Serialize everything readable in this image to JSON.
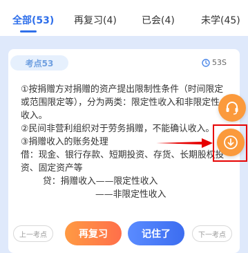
{
  "tabs": [
    {
      "label": "全部(53)",
      "active": true
    },
    {
      "label": "再复习(4)",
      "active": false
    },
    {
      "label": "已会(4)",
      "active": false
    },
    {
      "label": "未学(45)",
      "active": false
    }
  ],
  "card": {
    "tag": "考点53",
    "timer": "53S",
    "lines": [
      "①按捐赠方对捐赠的资产提出限制性条件（时间限定或范围限定等），分为两类：限定性收入和非限定性收入。",
      "②民间非营利组织对于劳务捐赠，不能确认收入。",
      "③捐赠收入的账务处理",
      "借：现金、银行存款、短期投资、存货、长期股权投资、固定资产等",
      "贷：捐赠收入——限定性收入",
      "——非限定性收入"
    ]
  },
  "buttons": {
    "prev": "上一考点",
    "review": "再复习",
    "remember": "记住了",
    "next": "下一考点"
  },
  "icons": {
    "timer": "clock-icon",
    "headset": "headset-icon",
    "download": "download-icon"
  },
  "colors": {
    "accent_blue": "#2f6fea",
    "orange": "#fb9a3c",
    "highlight_red": "#e60000"
  }
}
